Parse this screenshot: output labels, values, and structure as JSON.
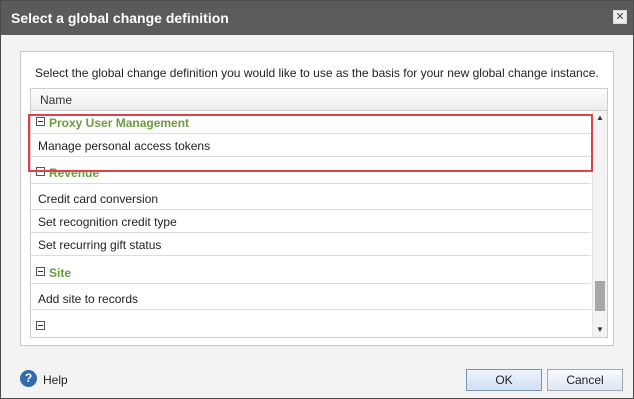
{
  "dialog": {
    "title": "Select a global change definition",
    "close_glyph": "✕",
    "instruction": "Select the global change definition you would like to use as the basis for your new global change instance."
  },
  "grid": {
    "column_header": "Name",
    "groups": [
      {
        "label": "Proxy User Management",
        "items": [
          "Manage personal access tokens"
        ]
      },
      {
        "label": "Revenue",
        "items": [
          "Credit card conversion",
          "Set recognition credit type",
          "Set recurring gift status"
        ]
      },
      {
        "label": "Site",
        "items": [
          "Add site to records"
        ]
      }
    ],
    "scroll_up_glyph": "▲",
    "scroll_down_glyph": "▼"
  },
  "footer": {
    "help_icon_glyph": "?",
    "help_label": "Help",
    "ok_label": "OK",
    "cancel_label": "Cancel"
  },
  "colors": {
    "titlebar": "#5b5b5b",
    "group_text": "#6a9c3f",
    "highlight": "#e0414a",
    "help_icon": "#2f6bb0"
  },
  "icons": {
    "close": "close-icon",
    "expander": "collapse-icon",
    "help": "help-icon"
  }
}
